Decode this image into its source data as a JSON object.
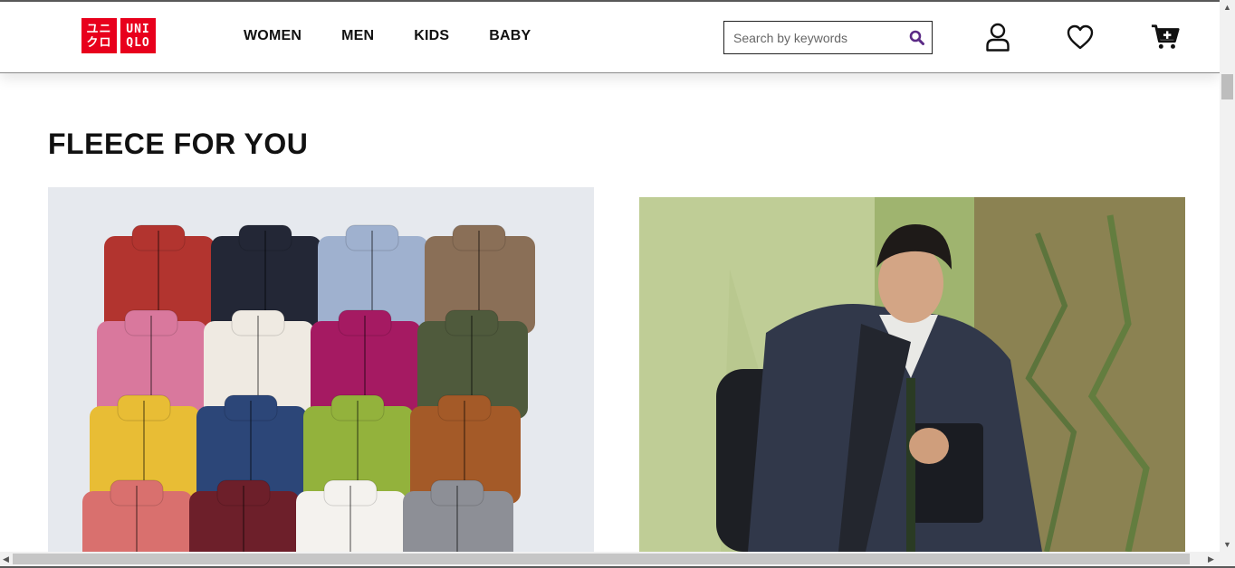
{
  "brand": {
    "logo_left": [
      "ユニ",
      "クロ"
    ],
    "logo_right": [
      "UNI",
      "QLO"
    ],
    "color": "#e8001c"
  },
  "nav": {
    "items": [
      {
        "label": "WOMEN"
      },
      {
        "label": "MEN"
      },
      {
        "label": "KIDS"
      },
      {
        "label": "BABY"
      }
    ]
  },
  "search": {
    "placeholder": "Search by keywords",
    "value": "",
    "icon": "search-icon",
    "icon_color": "#5b2a86"
  },
  "header_icons": [
    {
      "name": "account-icon"
    },
    {
      "name": "wishlist-heart-icon"
    },
    {
      "name": "cart-icon"
    }
  ],
  "main": {
    "section_title": "FLEECE FOR YOU",
    "fleece_grid_colors": [
      [
        "#b2342f",
        "#232736",
        "#9fb1cf",
        "#8a6f57"
      ],
      [
        "#d9789d",
        "#efeae2",
        "#a51a62",
        "#4f5a3c"
      ],
      [
        "#e8bd35",
        "#2c4678",
        "#93b23c",
        "#a45a28"
      ],
      [
        "#d9706e",
        "#6d1f2a",
        "#f4f2ee",
        "#8d8f96"
      ]
    ],
    "images": [
      {
        "name": "fleece-jackets-grid-image"
      },
      {
        "name": "man-in-fleece-jacket-image"
      }
    ]
  }
}
